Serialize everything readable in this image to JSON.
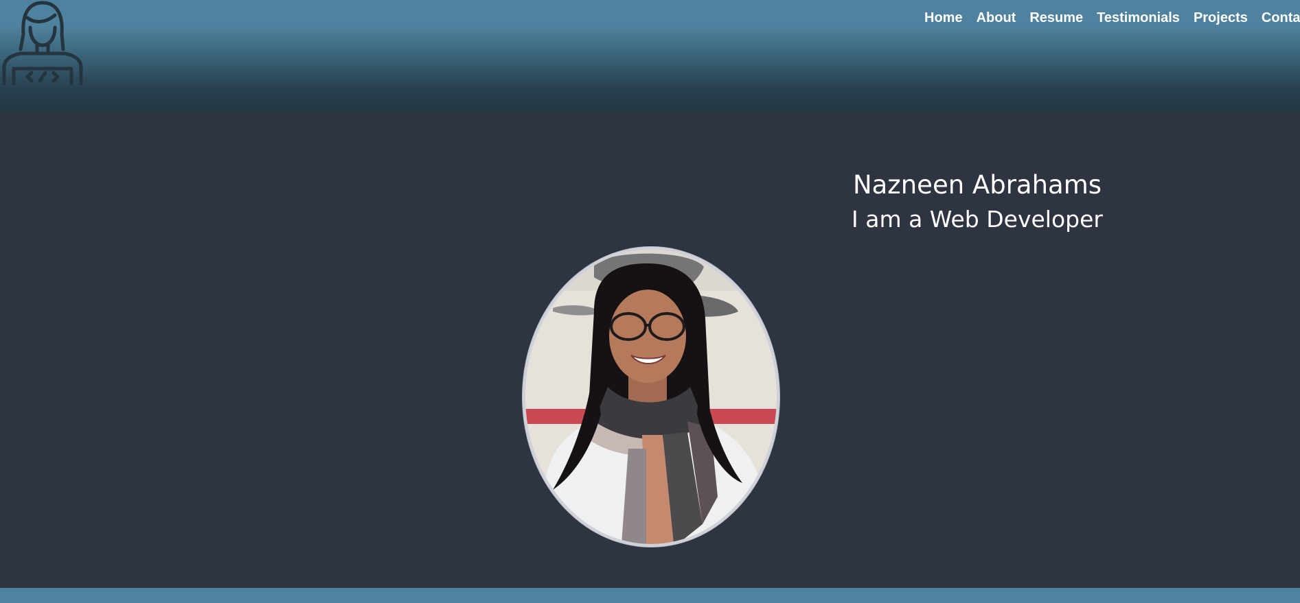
{
  "logo": {
    "icon": "developer-logo-icon"
  },
  "nav": {
    "items": [
      {
        "label": "Home"
      },
      {
        "label": "About"
      },
      {
        "label": "Resume"
      },
      {
        "label": "Testimonials"
      },
      {
        "label": "Projects"
      },
      {
        "label": "Contact"
      }
    ]
  },
  "hero": {
    "name": "Nazneen Abrahams",
    "role": "I am a Web Developer",
    "portrait": "profile-photo"
  },
  "colors": {
    "header": "#4f829f",
    "background": "#2e3540",
    "footer": "#4f829f",
    "text": "#ffffff"
  }
}
